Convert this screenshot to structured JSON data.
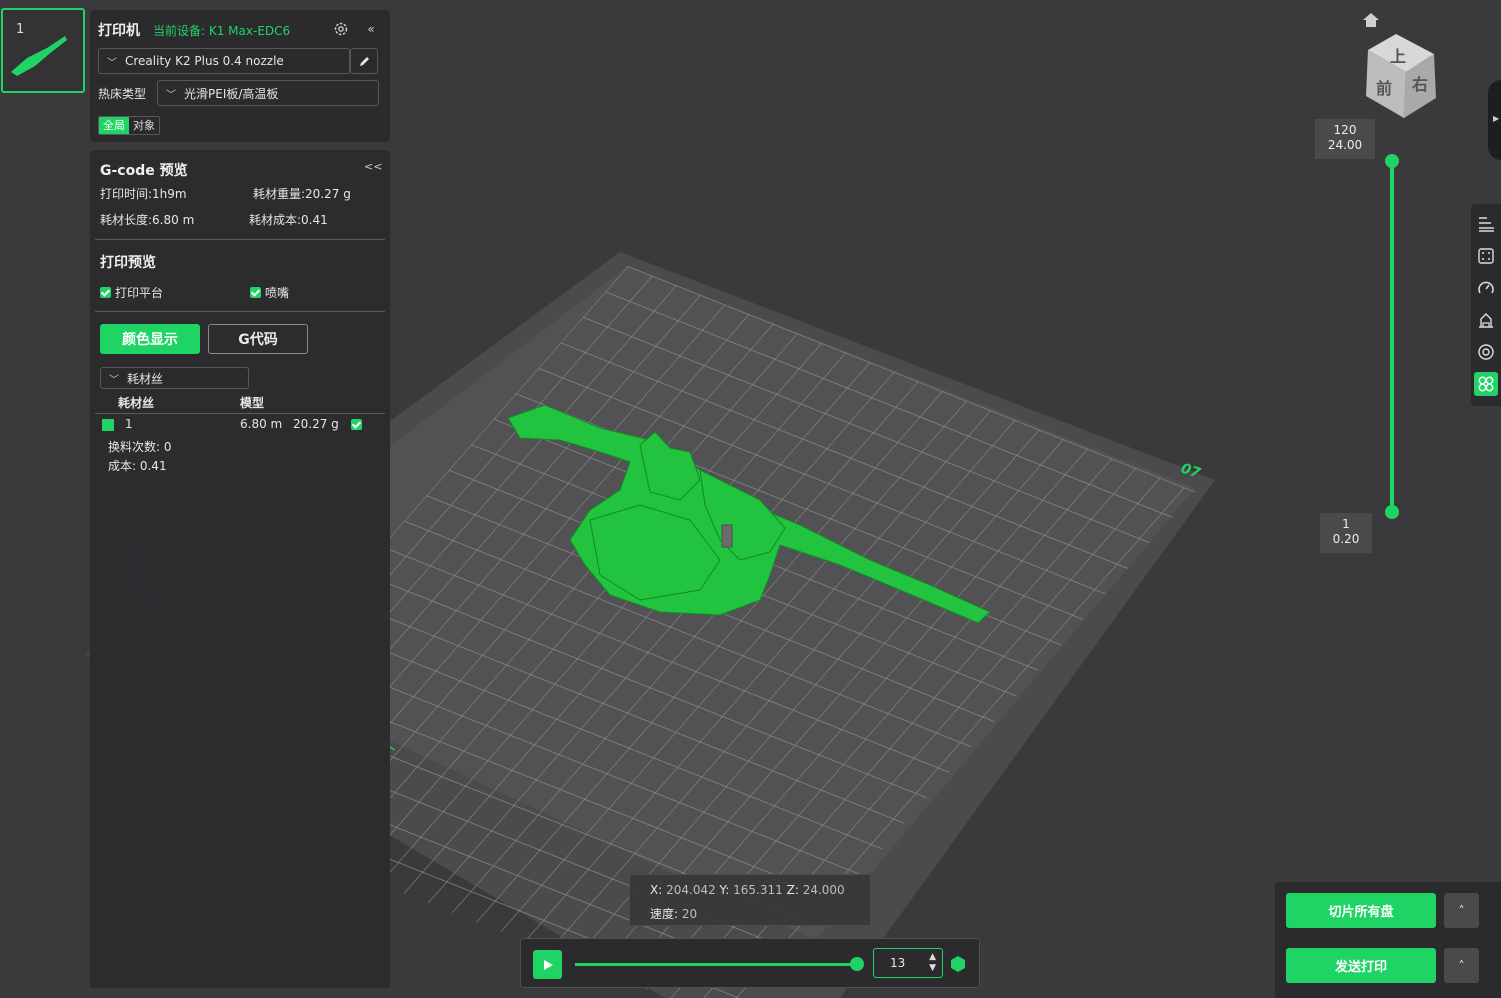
{
  "plate": {
    "number": "1"
  },
  "printer": {
    "title": "打印机",
    "current_device": "当前设备: K1 Max-EDC6",
    "profile": "Creality K2 Plus 0.4 nozzle",
    "bed_label": "热床类型",
    "bed_type": "光滑PEI板/高温板",
    "scope_global": "全局",
    "scope_object": "对象"
  },
  "gcode": {
    "title": "G-code 预览",
    "collapse": "<<",
    "print_time": "打印时间:1h9m",
    "filament_weight": "耗材重量:20.27 g",
    "filament_length": "耗材长度:6.80 m",
    "filament_cost": "耗材成本:0.41",
    "preview_title": "打印预览",
    "show_platform": "打印平台",
    "show_nozzle": "喷嘴",
    "color_display": "颜色显示",
    "gcode_tab": "G代码",
    "view_mode": "耗材丝",
    "col_filament": "耗材丝",
    "col_model": "模型",
    "rows": [
      {
        "id": "1",
        "length": "6.80 m",
        "weight": "20.27 g"
      }
    ],
    "swap_count": "换料次数:  0",
    "cost": "成本:  0.41"
  },
  "view_cube": {
    "top": "上",
    "front": "前",
    "right": "右"
  },
  "layers": {
    "top_layer": "120",
    "top_height": "24.00",
    "bottom_layer": "1",
    "bottom_height": "0.20"
  },
  "plate_label": "07",
  "position": {
    "x_label": "X:",
    "x": "204.042",
    "y_label": "Y:",
    "y": "165.311",
    "z_label": "Z:",
    "z": "24.000",
    "speed_label": "速度:",
    "speed": "20"
  },
  "playback": {
    "move_value": "13"
  },
  "actions": {
    "slice_all": "切片所有盘",
    "send_print": "发送打印"
  },
  "colors": {
    "accent": "#1fd465",
    "panel": "#2b2b2d",
    "background": "#3a3a3c"
  }
}
